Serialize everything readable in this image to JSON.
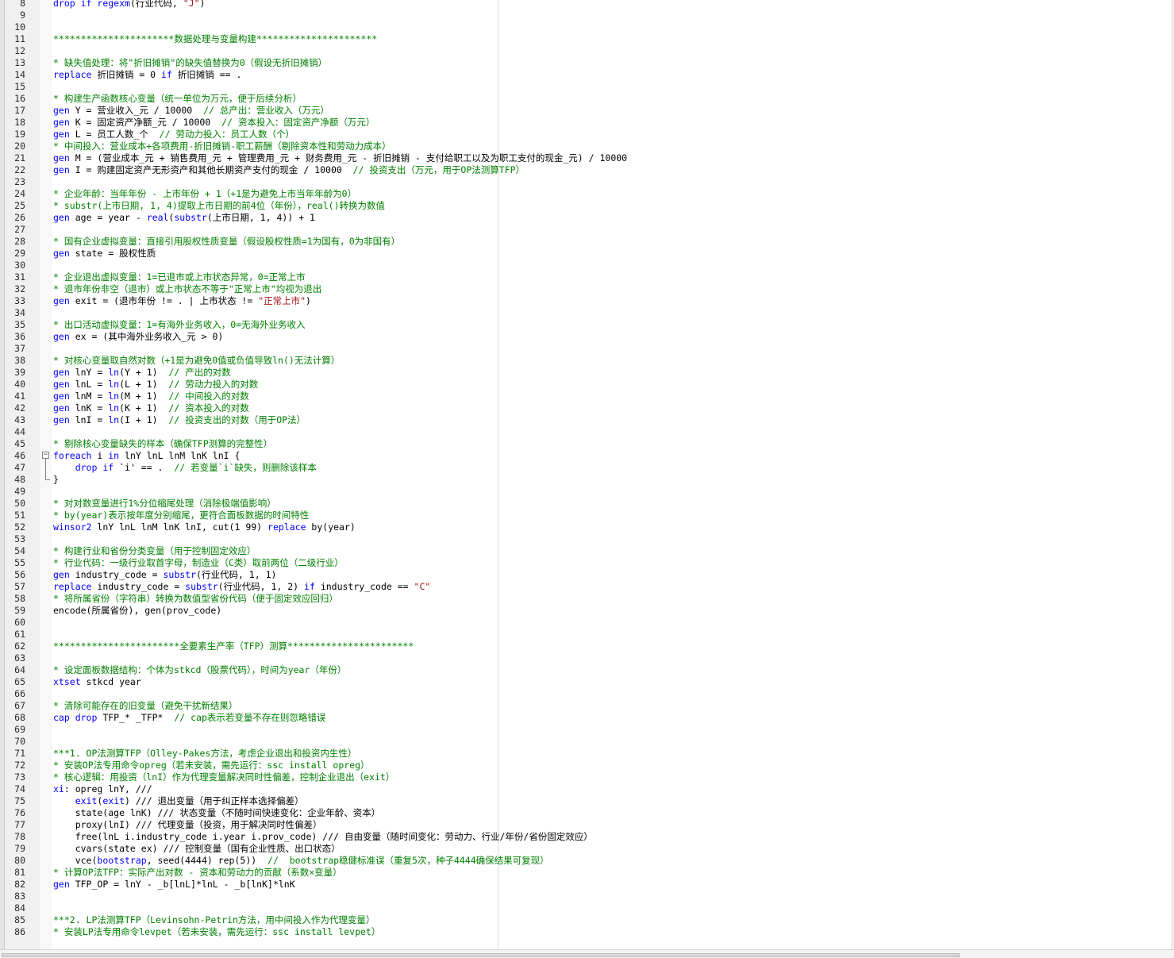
{
  "editor": {
    "language": "stata-do",
    "colors": {
      "keyword": "#0000ff",
      "function": "#0000ff",
      "string": "#a31515",
      "comment": "#008000",
      "text": "#000000",
      "gutter": "#f0f0f0"
    },
    "lines": [
      {
        "num": "8",
        "tokens": [
          {
            "k": "kw",
            "t": "drop if "
          },
          {
            "k": "fn",
            "t": "regexm"
          },
          {
            "k": "",
            "t": "(行业代码, "
          },
          {
            "k": "str",
            "t": "\"J\""
          },
          {
            "k": "",
            "t": ")"
          }
        ]
      },
      {
        "num": "9",
        "tokens": []
      },
      {
        "num": "10",
        "tokens": []
      },
      {
        "num": "11",
        "tokens": [
          {
            "k": "com",
            "t": "**********************数据处理与变量构建**********************"
          }
        ]
      },
      {
        "num": "12",
        "tokens": []
      },
      {
        "num": "13",
        "tokens": [
          {
            "k": "com",
            "t": "* 缺失值处理：将\"折旧摊销\"的缺失值替换为0（假设无折旧摊销）"
          }
        ]
      },
      {
        "num": "14",
        "tokens": [
          {
            "k": "kw",
            "t": "replace"
          },
          {
            "k": "",
            "t": " 折旧摊销 = 0 "
          },
          {
            "k": "kw",
            "t": "if"
          },
          {
            "k": "",
            "t": " 折旧摊销 == ."
          }
        ]
      },
      {
        "num": "15",
        "tokens": []
      },
      {
        "num": "16",
        "tokens": [
          {
            "k": "com",
            "t": "* 构建生产函数核心变量（统一单位为万元，便于后续分析）"
          }
        ]
      },
      {
        "num": "17",
        "tokens": [
          {
            "k": "kw",
            "t": "gen"
          },
          {
            "k": "",
            "t": " Y = 营业收入_元 / 10000  "
          },
          {
            "k": "com",
            "t": "// 总产出：营业收入（万元）"
          }
        ]
      },
      {
        "num": "18",
        "tokens": [
          {
            "k": "kw",
            "t": "gen"
          },
          {
            "k": "",
            "t": " K = 固定资产净额_元 / 10000  "
          },
          {
            "k": "com",
            "t": "// 资本投入：固定资产净额（万元）"
          }
        ]
      },
      {
        "num": "19",
        "tokens": [
          {
            "k": "kw",
            "t": "gen"
          },
          {
            "k": "",
            "t": " L = 员工人数_个  "
          },
          {
            "k": "com",
            "t": "// 劳动力投入：员工人数（个）"
          }
        ]
      },
      {
        "num": "20",
        "tokens": [
          {
            "k": "com",
            "t": "* 中间投入：营业成本+各项费用-折旧摊销-职工薪酬（剔除资本性和劳动力成本）"
          }
        ]
      },
      {
        "num": "21",
        "tokens": [
          {
            "k": "kw",
            "t": "gen"
          },
          {
            "k": "",
            "t": " M = (营业成本_元 + 销售费用_元 + 管理费用_元 + 财务费用_元 - 折旧摊销 - 支付给职工以及为职工支付的现金_元) / 10000"
          }
        ]
      },
      {
        "num": "22",
        "tokens": [
          {
            "k": "kw",
            "t": "gen"
          },
          {
            "k": "",
            "t": " I = 购建固定资产无形资产和其他长期资产支付的现金 / 10000  "
          },
          {
            "k": "com",
            "t": "// 投资支出（万元，用于OP法测算TFP）"
          }
        ]
      },
      {
        "num": "23",
        "tokens": []
      },
      {
        "num": "24",
        "tokens": [
          {
            "k": "com",
            "t": "* 企业年龄：当年年份 - 上市年份 + 1（+1是为避免上市当年年龄为0）"
          }
        ]
      },
      {
        "num": "25",
        "tokens": [
          {
            "k": "com",
            "t": "* substr(上市日期, 1, 4)提取上市日期的前4位（年份），real()转换为数值"
          }
        ]
      },
      {
        "num": "26",
        "tokens": [
          {
            "k": "kw",
            "t": "gen"
          },
          {
            "k": "",
            "t": " age = year - "
          },
          {
            "k": "fn",
            "t": "real"
          },
          {
            "k": "",
            "t": "("
          },
          {
            "k": "fn",
            "t": "substr"
          },
          {
            "k": "",
            "t": "(上市日期, 1, 4)) + 1"
          }
        ]
      },
      {
        "num": "27",
        "tokens": []
      },
      {
        "num": "28",
        "tokens": [
          {
            "k": "com",
            "t": "* 国有企业虚拟变量：直接引用股权性质变量（假设股权性质=1为国有，0为非国有）"
          }
        ]
      },
      {
        "num": "29",
        "tokens": [
          {
            "k": "kw",
            "t": "gen"
          },
          {
            "k": "",
            "t": " state = 股权性质"
          }
        ]
      },
      {
        "num": "30",
        "tokens": []
      },
      {
        "num": "31",
        "tokens": [
          {
            "k": "com",
            "t": "* 企业退出虚拟变量：1=已退市或上市状态异常，0=正常上市"
          }
        ]
      },
      {
        "num": "32",
        "tokens": [
          {
            "k": "com",
            "t": "* 退市年份非空（退市）或上市状态不等于\"正常上市\"均视为退出"
          }
        ]
      },
      {
        "num": "33",
        "tokens": [
          {
            "k": "kw",
            "t": "gen"
          },
          {
            "k": "",
            "t": " exit = (退市年份 != . | 上市状态 != "
          },
          {
            "k": "str",
            "t": "\"正常上市\""
          },
          {
            "k": "",
            "t": ")"
          }
        ]
      },
      {
        "num": "34",
        "tokens": []
      },
      {
        "num": "35",
        "tokens": [
          {
            "k": "com",
            "t": "* 出口活动虚拟变量：1=有海外业务收入，0=无海外业务收入"
          }
        ]
      },
      {
        "num": "36",
        "tokens": [
          {
            "k": "kw",
            "t": "gen"
          },
          {
            "k": "",
            "t": " ex = (其中海外业务收入_元 > 0)"
          }
        ]
      },
      {
        "num": "37",
        "tokens": []
      },
      {
        "num": "38",
        "tokens": [
          {
            "k": "com",
            "t": "* 对核心变量取自然对数（+1是为避免0值或负值导致ln()无法计算）"
          }
        ]
      },
      {
        "num": "39",
        "tokens": [
          {
            "k": "kw",
            "t": "gen"
          },
          {
            "k": "",
            "t": " lnY = "
          },
          {
            "k": "fn",
            "t": "ln"
          },
          {
            "k": "",
            "t": "(Y + 1)  "
          },
          {
            "k": "com",
            "t": "// 产出的对数"
          }
        ]
      },
      {
        "num": "40",
        "tokens": [
          {
            "k": "kw",
            "t": "gen"
          },
          {
            "k": "",
            "t": " lnL = "
          },
          {
            "k": "fn",
            "t": "ln"
          },
          {
            "k": "",
            "t": "(L + 1)  "
          },
          {
            "k": "com",
            "t": "// 劳动力投入的对数"
          }
        ]
      },
      {
        "num": "41",
        "tokens": [
          {
            "k": "kw",
            "t": "gen"
          },
          {
            "k": "",
            "t": " lnM = "
          },
          {
            "k": "fn",
            "t": "ln"
          },
          {
            "k": "",
            "t": "(M + 1)  "
          },
          {
            "k": "com",
            "t": "// 中间投入的对数"
          }
        ]
      },
      {
        "num": "42",
        "tokens": [
          {
            "k": "kw",
            "t": "gen"
          },
          {
            "k": "",
            "t": " lnK = "
          },
          {
            "k": "fn",
            "t": "ln"
          },
          {
            "k": "",
            "t": "(K + 1)  "
          },
          {
            "k": "com",
            "t": "// 资本投入的对数"
          }
        ]
      },
      {
        "num": "43",
        "tokens": [
          {
            "k": "kw",
            "t": "gen"
          },
          {
            "k": "",
            "t": " lnI = "
          },
          {
            "k": "fn",
            "t": "ln"
          },
          {
            "k": "",
            "t": "(I + 1)  "
          },
          {
            "k": "com",
            "t": "// 投资支出的对数（用于OP法）"
          }
        ]
      },
      {
        "num": "44",
        "tokens": []
      },
      {
        "num": "45",
        "tokens": [
          {
            "k": "com",
            "t": "* 剔除核心变量缺失的样本（确保TFP测算的完整性）"
          }
        ]
      },
      {
        "num": "46",
        "fold": "start",
        "tokens": [
          {
            "k": "kw",
            "t": "foreach"
          },
          {
            "k": "",
            "t": " i "
          },
          {
            "k": "kw",
            "t": "in"
          },
          {
            "k": "",
            "t": " lnY lnL lnM lnK lnI {"
          }
        ]
      },
      {
        "num": "47",
        "fold": "mid",
        "tokens": [
          {
            "k": "",
            "t": "    "
          },
          {
            "k": "kw",
            "t": "drop if"
          },
          {
            "k": "",
            "t": " `i' == .  "
          },
          {
            "k": "com",
            "t": "// 若变量`i`缺失，则删除该样本"
          }
        ]
      },
      {
        "num": "48",
        "fold": "end",
        "tokens": [
          {
            "k": "",
            "t": "}"
          }
        ]
      },
      {
        "num": "49",
        "tokens": []
      },
      {
        "num": "50",
        "tokens": [
          {
            "k": "com",
            "t": "* 对对数变量进行1%分位缩尾处理（消除极端值影响）"
          }
        ]
      },
      {
        "num": "51",
        "tokens": [
          {
            "k": "com",
            "t": "* by(year)表示按年度分别缩尾，更符合面板数据的时间特性"
          }
        ]
      },
      {
        "num": "52",
        "tokens": [
          {
            "k": "kw",
            "t": "winsor2"
          },
          {
            "k": "",
            "t": " lnY lnL lnM lnK lnI, cut(1 99) "
          },
          {
            "k": "kw",
            "t": "replace"
          },
          {
            "k": "",
            "t": " by(year)"
          }
        ]
      },
      {
        "num": "53",
        "tokens": []
      },
      {
        "num": "54",
        "tokens": [
          {
            "k": "com",
            "t": "* 构建行业和省份分类变量（用于控制固定效应）"
          }
        ]
      },
      {
        "num": "55",
        "tokens": [
          {
            "k": "com",
            "t": "* 行业代码：一级行业取首字母，制造业（C类）取前两位（二级行业）"
          }
        ]
      },
      {
        "num": "56",
        "tokens": [
          {
            "k": "kw",
            "t": "gen"
          },
          {
            "k": "",
            "t": " industry_code = "
          },
          {
            "k": "fn",
            "t": "substr"
          },
          {
            "k": "",
            "t": "(行业代码, 1, 1)"
          }
        ]
      },
      {
        "num": "57",
        "tokens": [
          {
            "k": "kw",
            "t": "replace"
          },
          {
            "k": "",
            "t": " industry_code = "
          },
          {
            "k": "fn",
            "t": "substr"
          },
          {
            "k": "",
            "t": "(行业代码, 1, 2) "
          },
          {
            "k": "kw",
            "t": "if"
          },
          {
            "k": "",
            "t": " industry_code == "
          },
          {
            "k": "str",
            "t": "\"C\""
          }
        ]
      },
      {
        "num": "58",
        "tokens": [
          {
            "k": "com",
            "t": "* 将所属省份（字符串）转换为数值型省份代码（便于固定效应回归）"
          }
        ]
      },
      {
        "num": "59",
        "tokens": [
          {
            "k": "",
            "t": "encode(所属省份), gen(prov_code)"
          }
        ]
      },
      {
        "num": "60",
        "tokens": []
      },
      {
        "num": "61",
        "tokens": []
      },
      {
        "num": "62",
        "tokens": [
          {
            "k": "com",
            "t": "***********************全要素生产率（TFP）测算***********************"
          }
        ]
      },
      {
        "num": "63",
        "tokens": []
      },
      {
        "num": "64",
        "tokens": [
          {
            "k": "com",
            "t": "* 设定面板数据结构：个体为stkcd（股票代码），时间为year（年份）"
          }
        ]
      },
      {
        "num": "65",
        "tokens": [
          {
            "k": "kw",
            "t": "xtset"
          },
          {
            "k": "",
            "t": " stkcd year"
          }
        ]
      },
      {
        "num": "66",
        "tokens": []
      },
      {
        "num": "67",
        "tokens": [
          {
            "k": "com",
            "t": "* 清除可能存在的旧变量（避免干扰新结果）"
          }
        ]
      },
      {
        "num": "68",
        "tokens": [
          {
            "k": "kw",
            "t": "cap drop"
          },
          {
            "k": "",
            "t": " TFP_* _TFP*  "
          },
          {
            "k": "com",
            "t": "// cap表示若变量不存在则忽略错误"
          }
        ]
      },
      {
        "num": "69",
        "tokens": []
      },
      {
        "num": "70",
        "tokens": []
      },
      {
        "num": "71",
        "tokens": [
          {
            "k": "com",
            "t": "***1. OP法测算TFP（Olley-Pakes方法，考虑企业退出和投资内生性）"
          }
        ]
      },
      {
        "num": "72",
        "tokens": [
          {
            "k": "com",
            "t": "* 安装OP法专用命令opreg（若未安装，需先运行：ssc install opreg）"
          }
        ]
      },
      {
        "num": "73",
        "tokens": [
          {
            "k": "com",
            "t": "* 核心逻辑：用投资（lnI）作为代理变量解决同时性偏差，控制企业退出（exit）"
          }
        ]
      },
      {
        "num": "74",
        "tokens": [
          {
            "k": "kw",
            "t": "xi"
          },
          {
            "k": "",
            "t": ": opreg lnY, ///"
          }
        ]
      },
      {
        "num": "75",
        "tokens": [
          {
            "k": "",
            "t": "    "
          },
          {
            "k": "kw",
            "t": "exit"
          },
          {
            "k": "",
            "t": "("
          },
          {
            "k": "kw",
            "t": "exit"
          },
          {
            "k": "",
            "t": ") /// 退出变量（用于纠正样本选择偏差）"
          }
        ]
      },
      {
        "num": "76",
        "tokens": [
          {
            "k": "",
            "t": "    state(age lnK) /// 状态变量（不随时间快速变化：企业年龄、资本）"
          }
        ]
      },
      {
        "num": "77",
        "tokens": [
          {
            "k": "",
            "t": "    proxy(lnI) /// 代理变量（投资，用于解决同时性偏差）"
          }
        ]
      },
      {
        "num": "78",
        "tokens": [
          {
            "k": "",
            "t": "    free(lnL i.industry_code i.year i.prov_code) /// 自由变量（随时间变化：劳动力、行业/年份/省份固定效应）"
          }
        ]
      },
      {
        "num": "79",
        "tokens": [
          {
            "k": "",
            "t": "    cvars(state ex) /// 控制变量（国有企业性质、出口状态）"
          }
        ]
      },
      {
        "num": "80",
        "tokens": [
          {
            "k": "",
            "t": "    vce("
          },
          {
            "k": "kw",
            "t": "bootstrap"
          },
          {
            "k": "",
            "t": ", seed(4444) rep(5))  "
          },
          {
            "k": "com",
            "t": "//  bootstrap稳健标准误（重复5次，种子4444确保结果可复现）"
          }
        ]
      },
      {
        "num": "81",
        "tokens": [
          {
            "k": "com",
            "t": "* 计算OP法TFP：实际产出对数 - 资本和劳动力的贡献（系数×变量）"
          }
        ]
      },
      {
        "num": "82",
        "tokens": [
          {
            "k": "kw",
            "t": "gen"
          },
          {
            "k": "",
            "t": " TFP_OP = lnY - _b[lnL]*lnL - _b[lnK]*lnK"
          }
        ]
      },
      {
        "num": "83",
        "tokens": []
      },
      {
        "num": "84",
        "tokens": []
      },
      {
        "num": "85",
        "tokens": [
          {
            "k": "com",
            "t": "***2. LP法测算TFP（Levinsohn-Petrin方法，用中间投入作为代理变量）"
          }
        ]
      },
      {
        "num": "86",
        "tokens": [
          {
            "k": "com",
            "t": "* 安装LP法专用命令levpet（若未安装，需先运行：ssc install levpet）"
          }
        ]
      }
    ]
  }
}
